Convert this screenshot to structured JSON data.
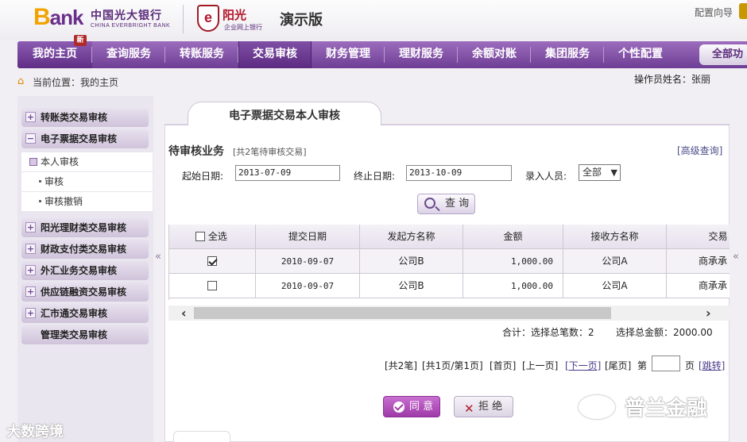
{
  "header": {
    "logo_b": "B",
    "logo_ank": "ank",
    "bank_name_cn": "中国光大银行",
    "bank_name_en": "CHINA EVERBRIGHT BANK",
    "partner_mark": "e",
    "partner_name": "阳光",
    "partner_sub": "企业网上银行",
    "demo_label": "演示版",
    "config_link": "配置向导"
  },
  "nav": {
    "items": [
      {
        "label": "我的主页"
      },
      {
        "label": "查询服务"
      },
      {
        "label": "转账服务"
      },
      {
        "label": "交易审核"
      },
      {
        "label": "财务管理"
      },
      {
        "label": "理财服务"
      },
      {
        "label": "余额对账"
      },
      {
        "label": "集团服务"
      },
      {
        "label": "个性配置"
      }
    ],
    "new_badge": "新",
    "all_functions": "全部功"
  },
  "breadcrumb": {
    "text": "当前位置：我的主页",
    "operator": "操作员姓名：张丽"
  },
  "sidebar": {
    "groups": [
      {
        "label": "转账类交易审核",
        "toggle": "+"
      },
      {
        "label": "电子票据交易审核",
        "toggle": "−"
      },
      {
        "label": "阳光理财类交易审核",
        "toggle": "+"
      },
      {
        "label": "财政支付类交易审核",
        "toggle": "+"
      },
      {
        "label": "外汇业务交易审核",
        "toggle": "+"
      },
      {
        "label": "供应链融资交易审核",
        "toggle": "+"
      },
      {
        "label": "汇市通交易审核",
        "toggle": "+"
      },
      {
        "label": "管理类交易审核",
        "toggle": ""
      }
    ],
    "subitems": [
      {
        "label": "本人审核"
      },
      {
        "label": "审核"
      },
      {
        "label": "审核撤销"
      }
    ]
  },
  "content": {
    "tab_title": "电子票据交易本人审核",
    "section_title": "待审核业务",
    "pending_count": "[共2笔待审核交易]",
    "advanced_query": "[高级查询]",
    "start_date_label": "起始日期:",
    "start_date": "2013-07-09",
    "end_date_label": "终止日期:",
    "end_date": "2013-10-09",
    "entry_user_label": "录入人员:",
    "entry_user_value": "全部",
    "query_button": "查 询"
  },
  "table": {
    "select_all": "全选",
    "headers": [
      "提交日期",
      "发起方名称",
      "金额",
      "接收方名称",
      "交易"
    ],
    "rows": [
      {
        "checked": true,
        "date": "2010-09-07",
        "initiator": "公司B",
        "amount": "1,000.00",
        "receiver": "公司A",
        "type": "商承承"
      },
      {
        "checked": false,
        "date": "2010-09-07",
        "initiator": "公司B",
        "amount": "1,000.00",
        "receiver": "公司A",
        "type": "商承承"
      }
    ]
  },
  "summary": {
    "selected_count": "合计：选择总笔数：2",
    "selected_amount": "选择总金额：2000.00"
  },
  "pager": {
    "total": "[共2笔]",
    "page_info": "[共1页/第1页]",
    "first": "[首页]",
    "prev": "[上一页]",
    "next": "[下一页]",
    "last": "[尾页]",
    "page_prefix": "第",
    "page_suffix": "页",
    "jump": "[跳转]"
  },
  "actions": {
    "agree": "同 意",
    "reject": "拒 绝"
  },
  "watermarks": {
    "left": "大数跨境",
    "right": "普兰金融"
  },
  "colors": {
    "nav_purple": "#7a47a0",
    "logo_gold": "#f1a400",
    "agree_purple": "#b04fbc",
    "reject_red": "#b01e2a"
  }
}
